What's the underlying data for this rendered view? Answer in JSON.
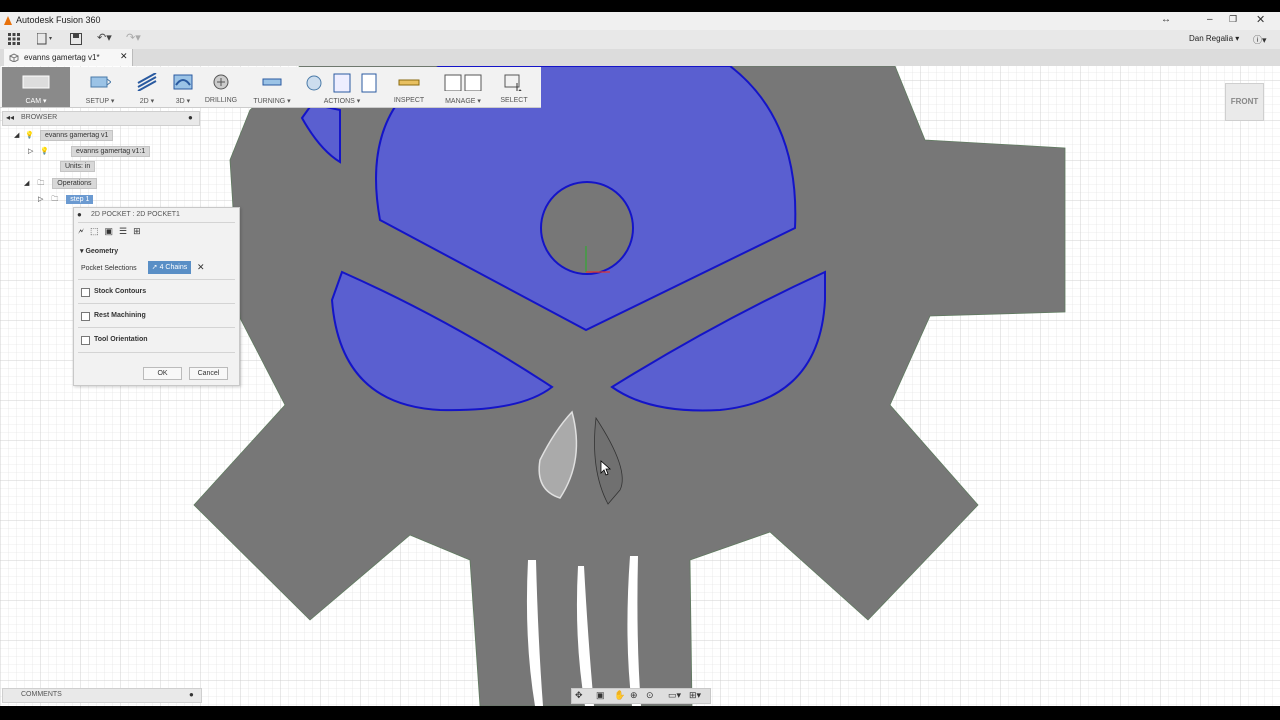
{
  "app": {
    "title": "Autodesk Fusion 360",
    "user": "Dan Regalia"
  },
  "document": {
    "tab_title": "evanns gamertag v1*"
  },
  "toolbar": {
    "items": [
      {
        "label": "CAM ▾"
      },
      {
        "label": "SETUP ▾"
      },
      {
        "label": "2D ▾"
      },
      {
        "label": "3D ▾"
      },
      {
        "label": "DRILLING"
      },
      {
        "label": "TURNING ▾"
      },
      {
        "label": "ACTIONS ▾"
      },
      {
        "label": "INSPECT"
      },
      {
        "label": "MANAGE ▾"
      },
      {
        "label": "SELECT"
      }
    ]
  },
  "browser": {
    "title": "BROWSER",
    "root": "evanns gamertag v1",
    "component": "evanns gamertag v1:1",
    "units": "Units: in",
    "operations": "Operations",
    "setup": "step 1"
  },
  "dialog": {
    "title": "2D POCKET : 2D POCKET1",
    "section": "Geometry",
    "pocket_label": "Pocket Selections",
    "pocket_value": "4 Chains",
    "options": [
      "Stock Contours",
      "Rest Machining",
      "Tool Orientation"
    ],
    "ok": "OK",
    "cancel": "Cancel"
  },
  "comments": "COMMENTS",
  "viewcube": "FRONT",
  "colors": {
    "selection": "#5a5fd0",
    "part": "#777777",
    "grid": "#d6d6d6"
  }
}
